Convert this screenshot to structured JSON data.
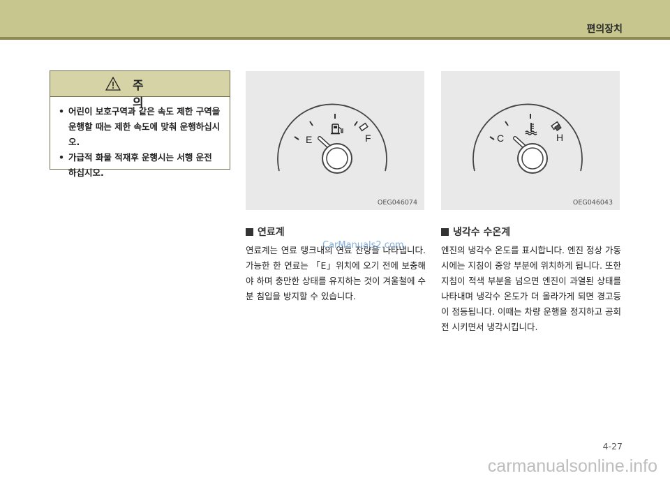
{
  "header": {
    "section": "편의장치"
  },
  "caution": {
    "title": "주  의",
    "items": [
      "어린이 보호구역과 같은 속도 제한 구역을 운행할 때는 제한 속도에 맞춰 운행하십시오.",
      "가급적 화물 적재후 운행시는 서행 운전 하십시오."
    ]
  },
  "fuel_gauge": {
    "code": "OEG046074",
    "left_label": "E",
    "right_label": "F",
    "icon": "fuel-pump-icon"
  },
  "temp_gauge": {
    "code": "OEG046043",
    "left_label": "C",
    "right_label": "H",
    "icon": "coolant-temperature-icon"
  },
  "fuel_section": {
    "title": "연료계",
    "text": "연료계는 연료 탱크내의 연료 잔량을 나타냅니다. 가능한 한 연료는 「E」위치에 오기 전에 보충해야 하며 충만한 상태를 유지하는 것이 겨울철에 수분 침입을 방지할 수 있습니다."
  },
  "temp_section": {
    "title": "냉각수 수온계",
    "text": "엔진의 냉각수 온도를 표시합니다. 엔진 정상 가동시에는 지침이 중앙 부분에 위치하게 됩니다. 또한 지침이 적색 부분을 넘으면 엔진이 과열된 상태를 나타내며 냉각수 온도가 더 올라가게 되면 경고등이 점등됩니다. 이때는 차량 운행을 정지하고 공회전 시키면서 냉각시킵니다."
  },
  "watermark": "CarManuals2.com",
  "page_number": "4-27",
  "footer_watermark": "carmanualsonline.info",
  "colors": {
    "header": "#c7c68e",
    "header_line": "#8f8c52",
    "caution_head": "#d6d4a6",
    "gauge_bg": "#e9e9e9"
  }
}
